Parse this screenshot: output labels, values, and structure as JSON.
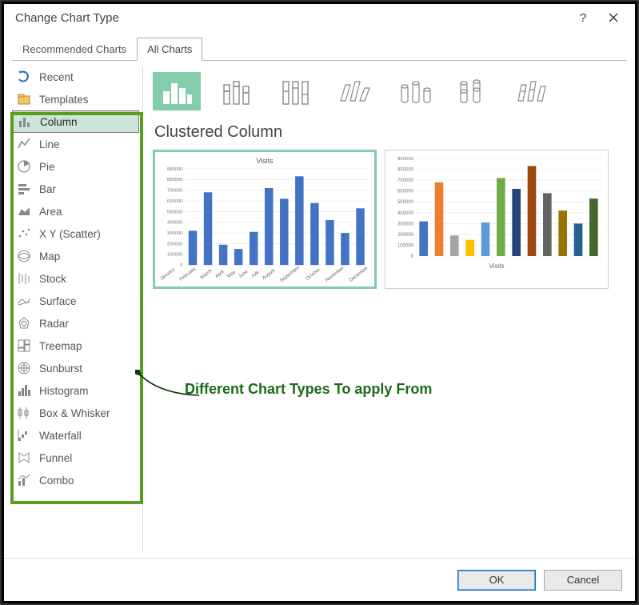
{
  "dialog": {
    "title": "Change Chart Type",
    "help": "?",
    "close": "✕"
  },
  "tabs": {
    "recommended": "Recommended Charts",
    "all": "All Charts"
  },
  "sidebar": {
    "items": [
      {
        "label": "Recent"
      },
      {
        "label": "Templates"
      },
      {
        "label": "Column"
      },
      {
        "label": "Line"
      },
      {
        "label": "Pie"
      },
      {
        "label": "Bar"
      },
      {
        "label": "Area"
      },
      {
        "label": "X Y (Scatter)"
      },
      {
        "label": "Map"
      },
      {
        "label": "Stock"
      },
      {
        "label": "Surface"
      },
      {
        "label": "Radar"
      },
      {
        "label": "Treemap"
      },
      {
        "label": "Sunburst"
      },
      {
        "label": "Histogram"
      },
      {
        "label": "Box & Whisker"
      },
      {
        "label": "Waterfall"
      },
      {
        "label": "Funnel"
      },
      {
        "label": "Combo"
      }
    ],
    "selected_index": 2
  },
  "subtype_selected": 0,
  "chart_name": "Clustered Column",
  "annotation": "Different Chart Types To apply From",
  "footer": {
    "ok": "OK",
    "cancel": "Cancel"
  },
  "preview1": {
    "title": "Visits",
    "series_color": "#4472C4",
    "x_axis": "Visits"
  },
  "preview2": {
    "title": "",
    "x_axis": "Visits",
    "categorical_colors": [
      "#4472C4",
      "#ED7D31",
      "#A5A5A5",
      "#FFC000",
      "#5B9BD5",
      "#70AD47",
      "#264478",
      "#9E480E",
      "#636363",
      "#997300",
      "#255E91",
      "#43682B"
    ]
  },
  "chart_data": {
    "type": "bar",
    "categories": [
      "January",
      "February",
      "March",
      "April",
      "May",
      "June",
      "July",
      "August",
      "September",
      "October",
      "November",
      "December"
    ],
    "values": [
      320000,
      680000,
      190000,
      150000,
      310000,
      720000,
      620000,
      830000,
      580000,
      420000,
      300000,
      530000
    ],
    "title": "Visits",
    "xlabel": "",
    "ylabel": "",
    "ylim": [
      0,
      900000
    ],
    "y_ticks": [
      0,
      100000,
      200000,
      300000,
      400000,
      500000,
      600000,
      700000,
      800000,
      900000
    ]
  }
}
